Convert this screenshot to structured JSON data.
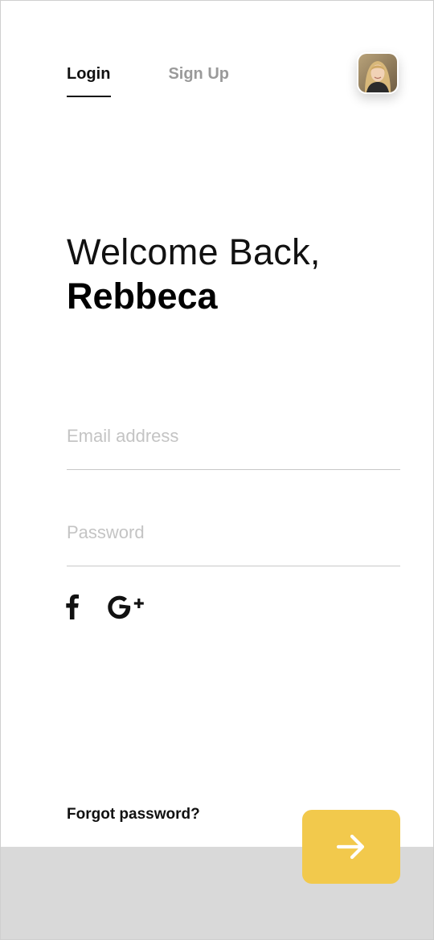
{
  "tabs": {
    "login": "Login",
    "signup": "Sign Up"
  },
  "avatar": {
    "alt": "User avatar"
  },
  "welcome": {
    "line1": "Welcome Back,",
    "name": "Rebbeca"
  },
  "form": {
    "email_placeholder": "Email address",
    "email_value": "",
    "password_placeholder": "Password",
    "password_value": ""
  },
  "social": {
    "facebook_icon": "facebook-icon",
    "google_icon": "google-plus-icon"
  },
  "forgot_label": "Forgot password?",
  "colors": {
    "accent": "#F2C94C",
    "band": "#D9D9D9",
    "placeholder": "#C4C4C4",
    "inactive_tab": "#9A9A9A"
  },
  "submit_icon": "arrow-right-icon"
}
